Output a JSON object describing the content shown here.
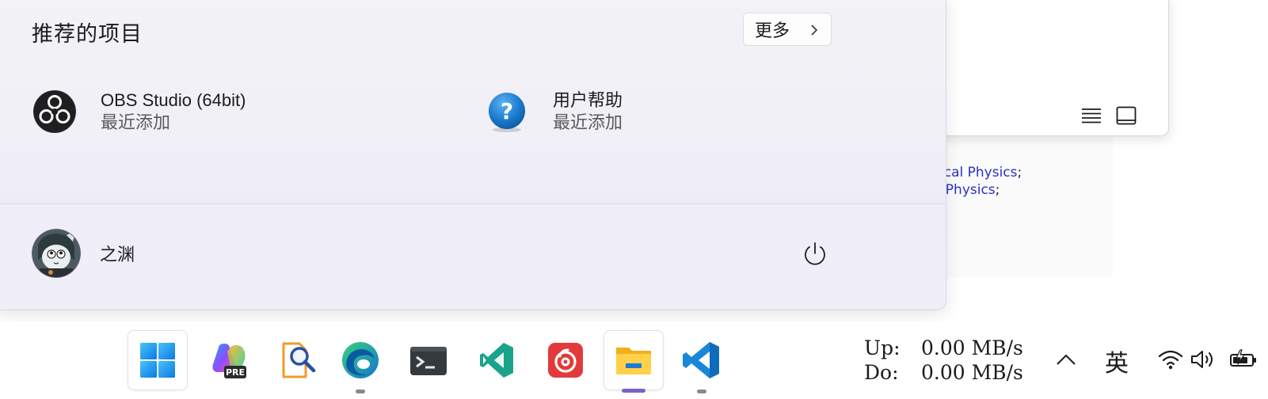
{
  "start_menu": {
    "recommended_title": "推荐的项目",
    "more_button": "更多",
    "items": [
      {
        "name": "OBS Studio (64bit)",
        "subtitle": "最近添加",
        "icon": "obs-icon"
      },
      {
        "name": "用户帮助",
        "subtitle": "最近添加",
        "icon": "help-icon"
      }
    ],
    "user": {
      "name": "之渊",
      "avatar": "avatar-icon"
    },
    "power_icon": "power-icon"
  },
  "background": {
    "doc_line1": "emical Physics",
    "doc_line1_punct": ";",
    "doc_line2": "of Physics",
    "doc_line2_punct": ";"
  },
  "taskbar": {
    "apps": [
      {
        "name": "Start",
        "icon": "windows-icon"
      },
      {
        "name": "Copilot PRE",
        "icon": "copilot-pre-icon",
        "badge": "PRE"
      },
      {
        "name": "Document search",
        "icon": "doc-search-icon"
      },
      {
        "name": "Microsoft Edge",
        "icon": "edge-icon"
      },
      {
        "name": "Terminal",
        "icon": "terminal-icon"
      },
      {
        "name": "Visual Studio",
        "icon": "visual-studio-icon"
      },
      {
        "name": "NetEase Cloud Music",
        "icon": "netease-music-icon"
      },
      {
        "name": "File Explorer",
        "icon": "file-explorer-icon"
      },
      {
        "name": "Visual Studio Code",
        "icon": "vscode-icon"
      }
    ],
    "net_speed": {
      "up_label": "Up:",
      "up_value": "0.00 MB/s",
      "down_label": "Do:",
      "down_value": "0.00 MB/s"
    },
    "ime": "英",
    "tray_icons": [
      "chevron-up-icon",
      "wifi-icon",
      "volume-icon",
      "battery-icon"
    ]
  },
  "colors": {
    "accent": "#7a63c9",
    "link": "#2a2fc8"
  }
}
